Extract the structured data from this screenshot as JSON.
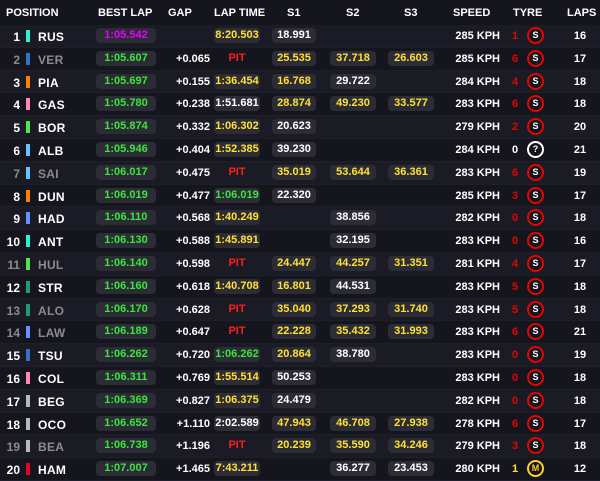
{
  "colors": {
    "purple": "#e800ff",
    "green": "#39e639",
    "yellow": "#ffe033",
    "white": "#ffffff",
    "pit": "#ff1e1e",
    "soft": "#e10600",
    "medium": "#ffd12e"
  },
  "header": {
    "position": "POSITION",
    "best_lap": "BEST LAP",
    "gap": "GAP",
    "lap_time": "LAP TIME",
    "s1": "S1",
    "s2": "S2",
    "s3": "S3",
    "speed": "SPEED",
    "tyre": "TYRE",
    "laps": "LAPS"
  },
  "rows": [
    {
      "pos": "1",
      "driver": "RUS",
      "out": false,
      "team_color": "#27f4d2",
      "best": "1:05.542",
      "best_c": "purple",
      "gap": "",
      "lt": "8:20.503",
      "lt_c": "yellow",
      "s1": "18.991",
      "s1_c": "white",
      "s2": "",
      "s2_c": "white",
      "s3": "",
      "s3_c": "white",
      "speed": "285 KPH",
      "stint": "1",
      "stint_c": "red",
      "tyre": "S",
      "tyre_icon": "soft-tyre-icon",
      "laps": "16"
    },
    {
      "pos": "2",
      "driver": "VER",
      "out": true,
      "team_color": "#3671c6",
      "best": "1:05.607",
      "best_c": "green",
      "gap": "+0.065",
      "lt": "PIT",
      "lt_c": "pit",
      "s1": "25.535",
      "s1_c": "yellow",
      "s2": "37.718",
      "s2_c": "yellow",
      "s3": "26.603",
      "s3_c": "yellow",
      "speed": "285 KPH",
      "stint": "6",
      "stint_c": "red",
      "tyre": "S",
      "tyre_icon": "soft-tyre-icon",
      "laps": "17"
    },
    {
      "pos": "3",
      "driver": "PIA",
      "out": false,
      "team_color": "#ff8000",
      "best": "1:05.697",
      "best_c": "green",
      "gap": "+0.155",
      "lt": "1:36.454",
      "lt_c": "yellow",
      "s1": "16.768",
      "s1_c": "yellow",
      "s2": "29.722",
      "s2_c": "white",
      "s3": "",
      "s3_c": "white",
      "speed": "284 KPH",
      "stint": "4",
      "stint_c": "red",
      "tyre": "S",
      "tyre_icon": "soft-tyre-icon",
      "laps": "18"
    },
    {
      "pos": "4",
      "driver": "GAS",
      "out": false,
      "team_color": "#ff87bc",
      "best": "1:05.780",
      "best_c": "green",
      "gap": "+0.238",
      "lt": "1:51.681",
      "lt_c": "white",
      "s1": "28.874",
      "s1_c": "yellow",
      "s2": "49.230",
      "s2_c": "yellow",
      "s3": "33.577",
      "s3_c": "yellow",
      "speed": "283 KPH",
      "stint": "6",
      "stint_c": "red",
      "tyre": "S",
      "tyre_icon": "soft-tyre-icon",
      "laps": "18"
    },
    {
      "pos": "5",
      "driver": "BOR",
      "out": false,
      "team_color": "#52e252",
      "best": "1:05.874",
      "best_c": "green",
      "gap": "+0.332",
      "lt": "1:06.302",
      "lt_c": "yellow",
      "s1": "20.623",
      "s1_c": "white",
      "s2": "",
      "s2_c": "white",
      "s3": "",
      "s3_c": "white",
      "speed": "279 KPH",
      "stint": "2",
      "stint_c": "red",
      "tyre": "S",
      "tyre_icon": "soft-tyre-icon",
      "laps": "20"
    },
    {
      "pos": "6",
      "driver": "ALB",
      "out": false,
      "team_color": "#64c4ff",
      "best": "1:05.946",
      "best_c": "green",
      "gap": "+0.404",
      "lt": "1:52.385",
      "lt_c": "yellow",
      "s1": "39.230",
      "s1_c": "white",
      "s2": "",
      "s2_c": "white",
      "s3": "",
      "s3_c": "white",
      "speed": "284 KPH",
      "stint": "0",
      "stint_c": "white",
      "tyre": "?",
      "tyre_icon": "unknown-tyre-icon",
      "laps": "21"
    },
    {
      "pos": "7",
      "driver": "SAI",
      "out": true,
      "team_color": "#64c4ff",
      "best": "1:06.017",
      "best_c": "green",
      "gap": "+0.475",
      "lt": "PIT",
      "lt_c": "pit",
      "s1": "35.019",
      "s1_c": "yellow",
      "s2": "53.644",
      "s2_c": "yellow",
      "s3": "36.361",
      "s3_c": "yellow",
      "speed": "283 KPH",
      "stint": "6",
      "stint_c": "red",
      "tyre": "S",
      "tyre_icon": "soft-tyre-icon",
      "laps": "19"
    },
    {
      "pos": "8",
      "driver": "DUN",
      "out": false,
      "team_color": "#ff8000",
      "best": "1:06.019",
      "best_c": "green",
      "gap": "+0.477",
      "lt": "1:06.019",
      "lt_c": "green",
      "s1": "22.320",
      "s1_c": "white",
      "s2": "",
      "s2_c": "white",
      "s3": "",
      "s3_c": "white",
      "speed": "285 KPH",
      "stint": "3",
      "stint_c": "red",
      "tyre": "S",
      "tyre_icon": "soft-tyre-icon",
      "laps": "17"
    },
    {
      "pos": "9",
      "driver": "HAD",
      "out": false,
      "team_color": "#6692ff",
      "best": "1:06.110",
      "best_c": "green",
      "gap": "+0.568",
      "lt": "1:40.249",
      "lt_c": "yellow",
      "s1": "",
      "s1_c": "white",
      "s2": "38.856",
      "s2_c": "white",
      "s3": "",
      "s3_c": "white",
      "speed": "282 KPH",
      "stint": "0",
      "stint_c": "red",
      "tyre": "S",
      "tyre_icon": "soft-tyre-icon",
      "laps": "18"
    },
    {
      "pos": "10",
      "driver": "ANT",
      "out": false,
      "team_color": "#27f4d2",
      "best": "1:06.130",
      "best_c": "green",
      "gap": "+0.588",
      "lt": "1:45.891",
      "lt_c": "yellow",
      "s1": "",
      "s1_c": "white",
      "s2": "32.195",
      "s2_c": "white",
      "s3": "",
      "s3_c": "white",
      "speed": "283 KPH",
      "stint": "0",
      "stint_c": "red",
      "tyre": "S",
      "tyre_icon": "soft-tyre-icon",
      "laps": "16"
    },
    {
      "pos": "11",
      "driver": "HUL",
      "out": true,
      "team_color": "#52e252",
      "best": "1:06.140",
      "best_c": "green",
      "gap": "+0.598",
      "lt": "PIT",
      "lt_c": "pit",
      "s1": "24.447",
      "s1_c": "yellow",
      "s2": "44.257",
      "s2_c": "yellow",
      "s3": "31.351",
      "s3_c": "yellow",
      "speed": "281 KPH",
      "stint": "4",
      "stint_c": "red",
      "tyre": "S",
      "tyre_icon": "soft-tyre-icon",
      "laps": "17"
    },
    {
      "pos": "12",
      "driver": "STR",
      "out": false,
      "team_color": "#229971",
      "best": "1:06.160",
      "best_c": "green",
      "gap": "+0.618",
      "lt": "1:40.708",
      "lt_c": "yellow",
      "s1": "16.801",
      "s1_c": "yellow",
      "s2": "44.531",
      "s2_c": "white",
      "s3": "",
      "s3_c": "white",
      "speed": "283 KPH",
      "stint": "5",
      "stint_c": "red",
      "tyre": "S",
      "tyre_icon": "soft-tyre-icon",
      "laps": "18"
    },
    {
      "pos": "13",
      "driver": "ALO",
      "out": true,
      "team_color": "#229971",
      "best": "1:06.170",
      "best_c": "green",
      "gap": "+0.628",
      "lt": "PIT",
      "lt_c": "pit",
      "s1": "35.040",
      "s1_c": "yellow",
      "s2": "37.293",
      "s2_c": "yellow",
      "s3": "31.740",
      "s3_c": "yellow",
      "speed": "283 KPH",
      "stint": "5",
      "stint_c": "red",
      "tyre": "S",
      "tyre_icon": "soft-tyre-icon",
      "laps": "18"
    },
    {
      "pos": "14",
      "driver": "LAW",
      "out": true,
      "team_color": "#6692ff",
      "best": "1:06.189",
      "best_c": "green",
      "gap": "+0.647",
      "lt": "PIT",
      "lt_c": "pit",
      "s1": "22.228",
      "s1_c": "yellow",
      "s2": "35.432",
      "s2_c": "yellow",
      "s3": "31.993",
      "s3_c": "yellow",
      "speed": "283 KPH",
      "stint": "6",
      "stint_c": "red",
      "tyre": "S",
      "tyre_icon": "soft-tyre-icon",
      "laps": "21"
    },
    {
      "pos": "15",
      "driver": "TSU",
      "out": false,
      "team_color": "#3671c6",
      "best": "1:06.262",
      "best_c": "green",
      "gap": "+0.720",
      "lt": "1:06.262",
      "lt_c": "green",
      "s1": "20.864",
      "s1_c": "yellow",
      "s2": "38.780",
      "s2_c": "white",
      "s3": "",
      "s3_c": "white",
      "speed": "283 KPH",
      "stint": "0",
      "stint_c": "red",
      "tyre": "S",
      "tyre_icon": "soft-tyre-icon",
      "laps": "19"
    },
    {
      "pos": "16",
      "driver": "COL",
      "out": false,
      "team_color": "#ff87bc",
      "best": "1:06.311",
      "best_c": "green",
      "gap": "+0.769",
      "lt": "1:55.514",
      "lt_c": "yellow",
      "s1": "50.253",
      "s1_c": "white",
      "s2": "",
      "s2_c": "white",
      "s3": "",
      "s3_c": "white",
      "speed": "283 KPH",
      "stint": "0",
      "stint_c": "red",
      "tyre": "S",
      "tyre_icon": "soft-tyre-icon",
      "laps": "18"
    },
    {
      "pos": "17",
      "driver": "BEG",
      "out": false,
      "team_color": "#b6babd",
      "best": "1:06.369",
      "best_c": "green",
      "gap": "+0.827",
      "lt": "1:06.375",
      "lt_c": "yellow",
      "s1": "24.479",
      "s1_c": "white",
      "s2": "",
      "s2_c": "white",
      "s3": "",
      "s3_c": "white",
      "speed": "282 KPH",
      "stint": "0",
      "stint_c": "red",
      "tyre": "S",
      "tyre_icon": "soft-tyre-icon",
      "laps": "18"
    },
    {
      "pos": "18",
      "driver": "OCO",
      "out": false,
      "team_color": "#b6babd",
      "best": "1:06.652",
      "best_c": "green",
      "gap": "+1.110",
      "lt": "2:02.589",
      "lt_c": "white",
      "s1": "47.943",
      "s1_c": "yellow",
      "s2": "46.708",
      "s2_c": "yellow",
      "s3": "27.938",
      "s3_c": "yellow",
      "speed": "278 KPH",
      "stint": "6",
      "stint_c": "red",
      "tyre": "S",
      "tyre_icon": "soft-tyre-icon",
      "laps": "17"
    },
    {
      "pos": "19",
      "driver": "BEA",
      "out": true,
      "team_color": "#b6babd",
      "best": "1:06.738",
      "best_c": "green",
      "gap": "+1.196",
      "lt": "PIT",
      "lt_c": "pit",
      "s1": "20.239",
      "s1_c": "yellow",
      "s2": "35.590",
      "s2_c": "yellow",
      "s3": "34.246",
      "s3_c": "yellow",
      "speed": "279 KPH",
      "stint": "3",
      "stint_c": "red",
      "tyre": "S",
      "tyre_icon": "soft-tyre-icon",
      "laps": "18"
    },
    {
      "pos": "20",
      "driver": "HAM",
      "out": false,
      "team_color": "#e8002d",
      "best": "1:07.007",
      "best_c": "green",
      "gap": "+1.465",
      "lt": "7:43.211",
      "lt_c": "yellow",
      "s1": "",
      "s1_c": "white",
      "s2": "36.277",
      "s2_c": "white",
      "s3": "23.453",
      "s3_c": "white",
      "speed": "280 KPH",
      "stint": "1",
      "stint_c": "yellow",
      "tyre": "M",
      "tyre_icon": "medium-tyre-icon",
      "laps": "12"
    }
  ]
}
